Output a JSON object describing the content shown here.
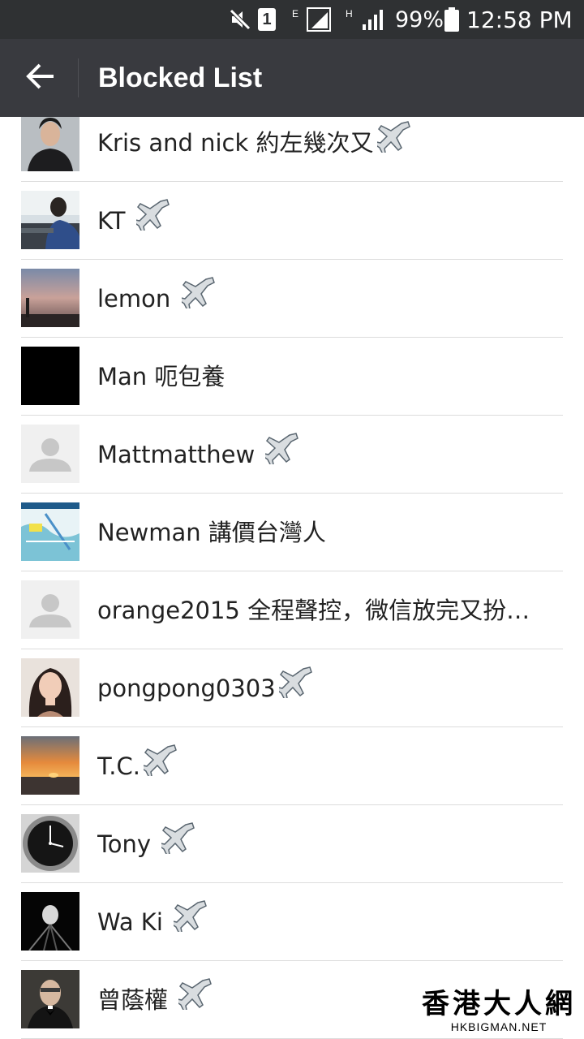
{
  "status_bar": {
    "sim_slot": "1",
    "network_e": "E",
    "network_h": "H",
    "battery_percent": "99%",
    "time": "12:58 PM",
    "icons": [
      "mute-icon",
      "sim-1-icon",
      "signal-e-icon",
      "signal-h-icon",
      "battery-icon"
    ]
  },
  "toolbar": {
    "title": "Blocked List",
    "back_icon": "arrow-left-icon"
  },
  "contacts": [
    {
      "name": "Kris and nick 約左幾次又",
      "plane": true,
      "avatar": "person-dark-photo"
    },
    {
      "name": "KT ",
      "plane": true,
      "avatar": "person-in-car-photo"
    },
    {
      "name": "lemon ",
      "plane": true,
      "avatar": "sunset-sky-photo"
    },
    {
      "name": "Man 呃包養",
      "plane": false,
      "avatar": "black-square"
    },
    {
      "name": "Mattmatthew ",
      "plane": true,
      "avatar": "default-avatar-icon"
    },
    {
      "name": "Newman 講價台灣人",
      "plane": false,
      "avatar": "map-photo"
    },
    {
      "name": "orange2015  全程聲控，微信放完又扮…",
      "plane": false,
      "avatar": "default-avatar-icon"
    },
    {
      "name": "pongpong0303",
      "plane": true,
      "avatar": "woman-selfie-photo"
    },
    {
      "name": "T.C.",
      "plane": true,
      "avatar": "sea-sunset-photo"
    },
    {
      "name": "Tony ",
      "plane": true,
      "avatar": "watch-photo"
    },
    {
      "name": "Wa Ki ",
      "plane": true,
      "avatar": "tunnel-photo"
    },
    {
      "name": "曾蔭權 ",
      "plane": true,
      "avatar": "man-bowtie-photo"
    }
  ],
  "watermark": {
    "cn": "香港大人網",
    "en": "HKBIGMAN.NET"
  },
  "colors": {
    "status_bar_bg": "#2f3133",
    "toolbar_bg": "#393a3f",
    "list_bg": "#ffffff",
    "divider": "#dcdcdc",
    "text": "#222222"
  }
}
